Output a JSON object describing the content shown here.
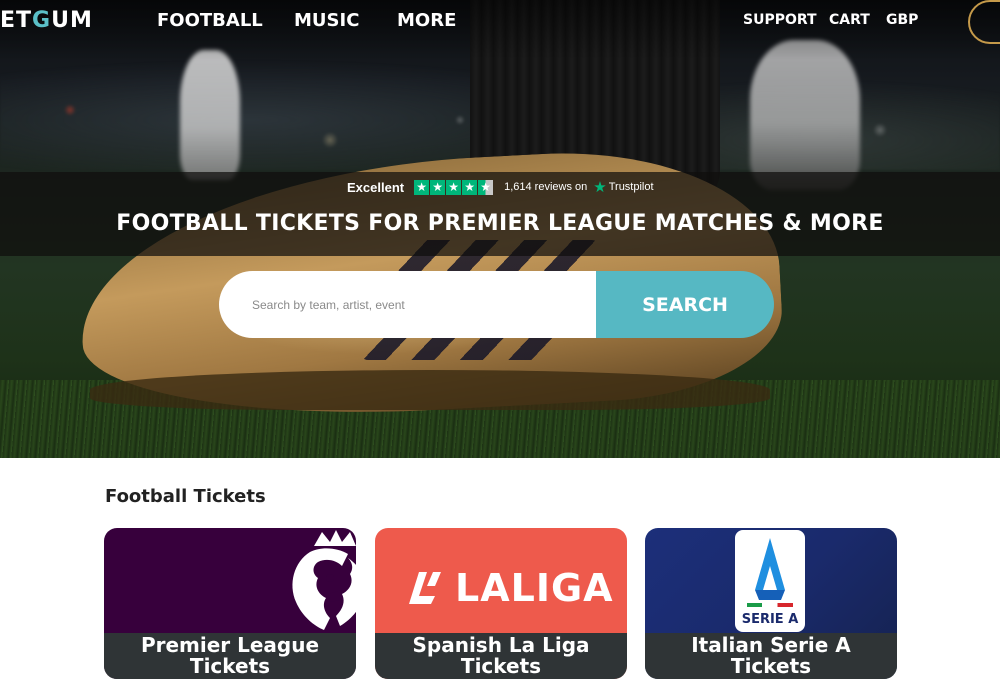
{
  "header": {
    "logo_main": "ET",
    "logo_accent": "G",
    "logo_tail": "UM",
    "nav": [
      "FOOTBALL",
      "MUSIC",
      "MORE"
    ],
    "utility": [
      "SUPPORT",
      "CART",
      "GBP"
    ]
  },
  "trustpilot": {
    "rating_label": "Excellent",
    "stars": 4.5,
    "reviews_text": "1,614 reviews on",
    "brand": "Trustpilot"
  },
  "hero": {
    "heading": "FOOTBALL TICKETS FOR PREMIER LEAGUE MATCHES & MORE"
  },
  "search": {
    "placeholder": "Search by team, artist, event",
    "button_label": "SEARCH"
  },
  "football_section": {
    "title": "Football Tickets",
    "cards": [
      {
        "caption": "Premier League Tickets",
        "logo": "premier-league-lion-icon"
      },
      {
        "caption": "Spanish La Liga Tickets",
        "logo_text": "LALIGA"
      },
      {
        "caption": "Italian Serie A Tickets",
        "logo_text": "SERIE A"
      }
    ]
  },
  "colors": {
    "accent": "#56b8c3",
    "premier_league": "#37003c",
    "laliga": "#ee5a4c",
    "serie_a": "#1c2f7a",
    "trustpilot_green": "#00b67a",
    "caption_bg": "#2f3436"
  }
}
